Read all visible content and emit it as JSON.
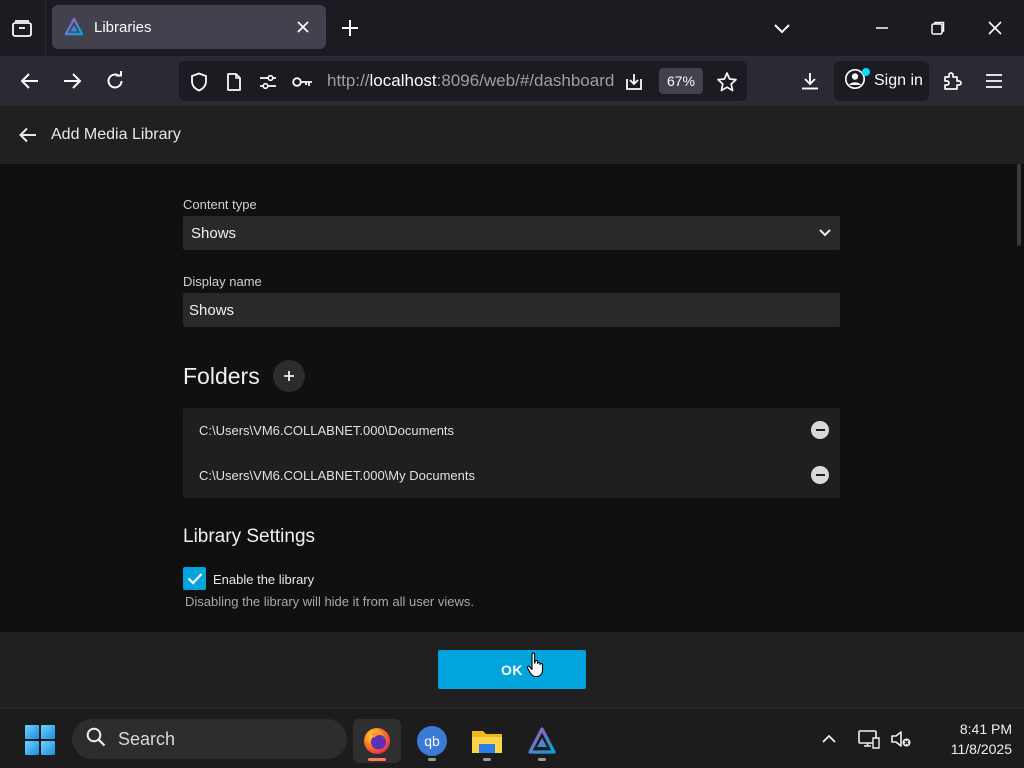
{
  "browser": {
    "tab": {
      "title": "Libraries"
    },
    "url": {
      "prefix": "http://",
      "host": "localhost",
      "rest": ":8096/web/#/dashboard"
    },
    "zoom": "67%",
    "signin_label": "Sign in"
  },
  "app": {
    "header_title": "Add Media Library",
    "content_type": {
      "label": "Content type",
      "value": "Shows"
    },
    "display_name": {
      "label": "Display name",
      "value": "Shows"
    },
    "folders": {
      "title": "Folders",
      "items": [
        {
          "path": "C:\\Users\\VM6.COLLABNET.000\\Documents"
        },
        {
          "path": "C:\\Users\\VM6.COLLABNET.000\\My Documents"
        }
      ]
    },
    "library_settings": {
      "title": "Library Settings",
      "enable_label": "Enable the library",
      "enable_checked": true,
      "enable_description": "Disabling the library will hide it from all user views."
    },
    "ok_label": "OK",
    "accent_color": "#00a4dc"
  },
  "taskbar": {
    "search_label": "Search",
    "time": "8:41 PM",
    "date": "11/8/2025"
  }
}
